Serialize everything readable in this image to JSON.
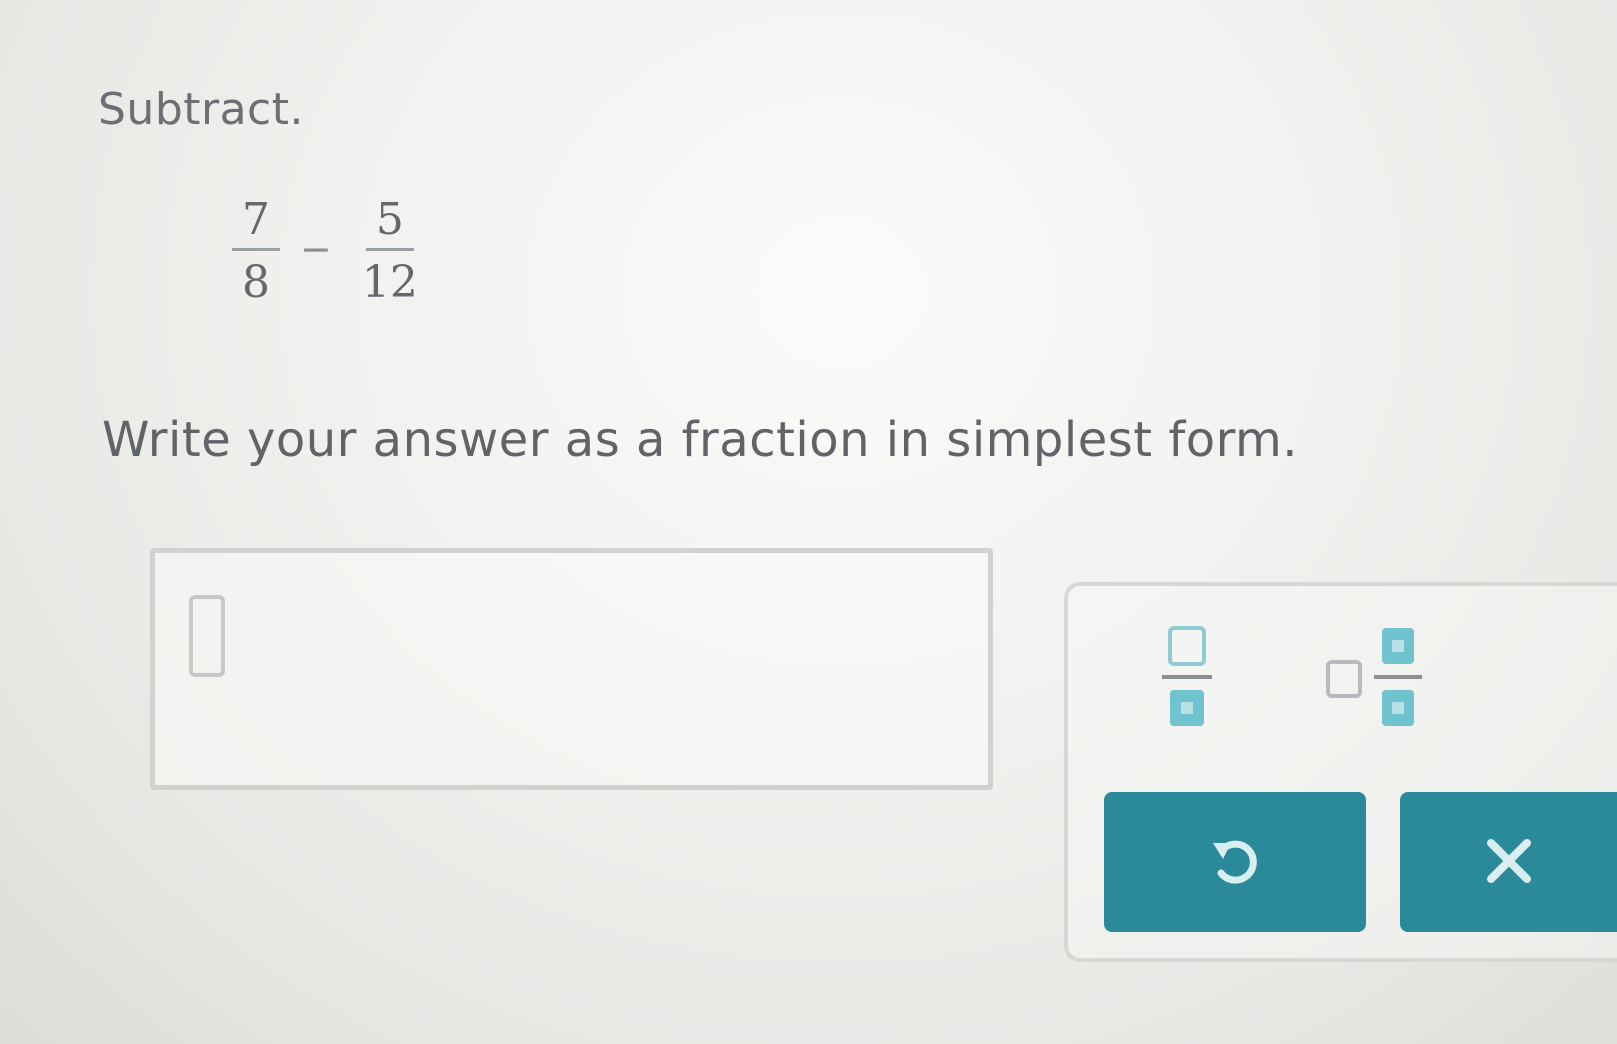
{
  "problem": {
    "instruction": "Subtract.",
    "expression": {
      "first": {
        "numerator": "7",
        "denominator": "8"
      },
      "operator": "−",
      "second": {
        "numerator": "5",
        "denominator": "12"
      }
    },
    "prompt": "Write your answer as a fraction in simplest form."
  },
  "answer": {
    "value": ""
  },
  "keypad": {
    "keys": [
      {
        "name": "fraction-template",
        "icon": "fraction-icon"
      },
      {
        "name": "mixed-number-template",
        "icon": "mixed-number-icon"
      }
    ],
    "actions": [
      {
        "name": "undo",
        "icon": "undo-icon"
      },
      {
        "name": "clear",
        "icon": "close-icon"
      }
    ]
  },
  "colors": {
    "accent": "#2a8a99",
    "accent_light": "#6fc3cf",
    "text": "#606468",
    "background": "#eeeeec"
  }
}
